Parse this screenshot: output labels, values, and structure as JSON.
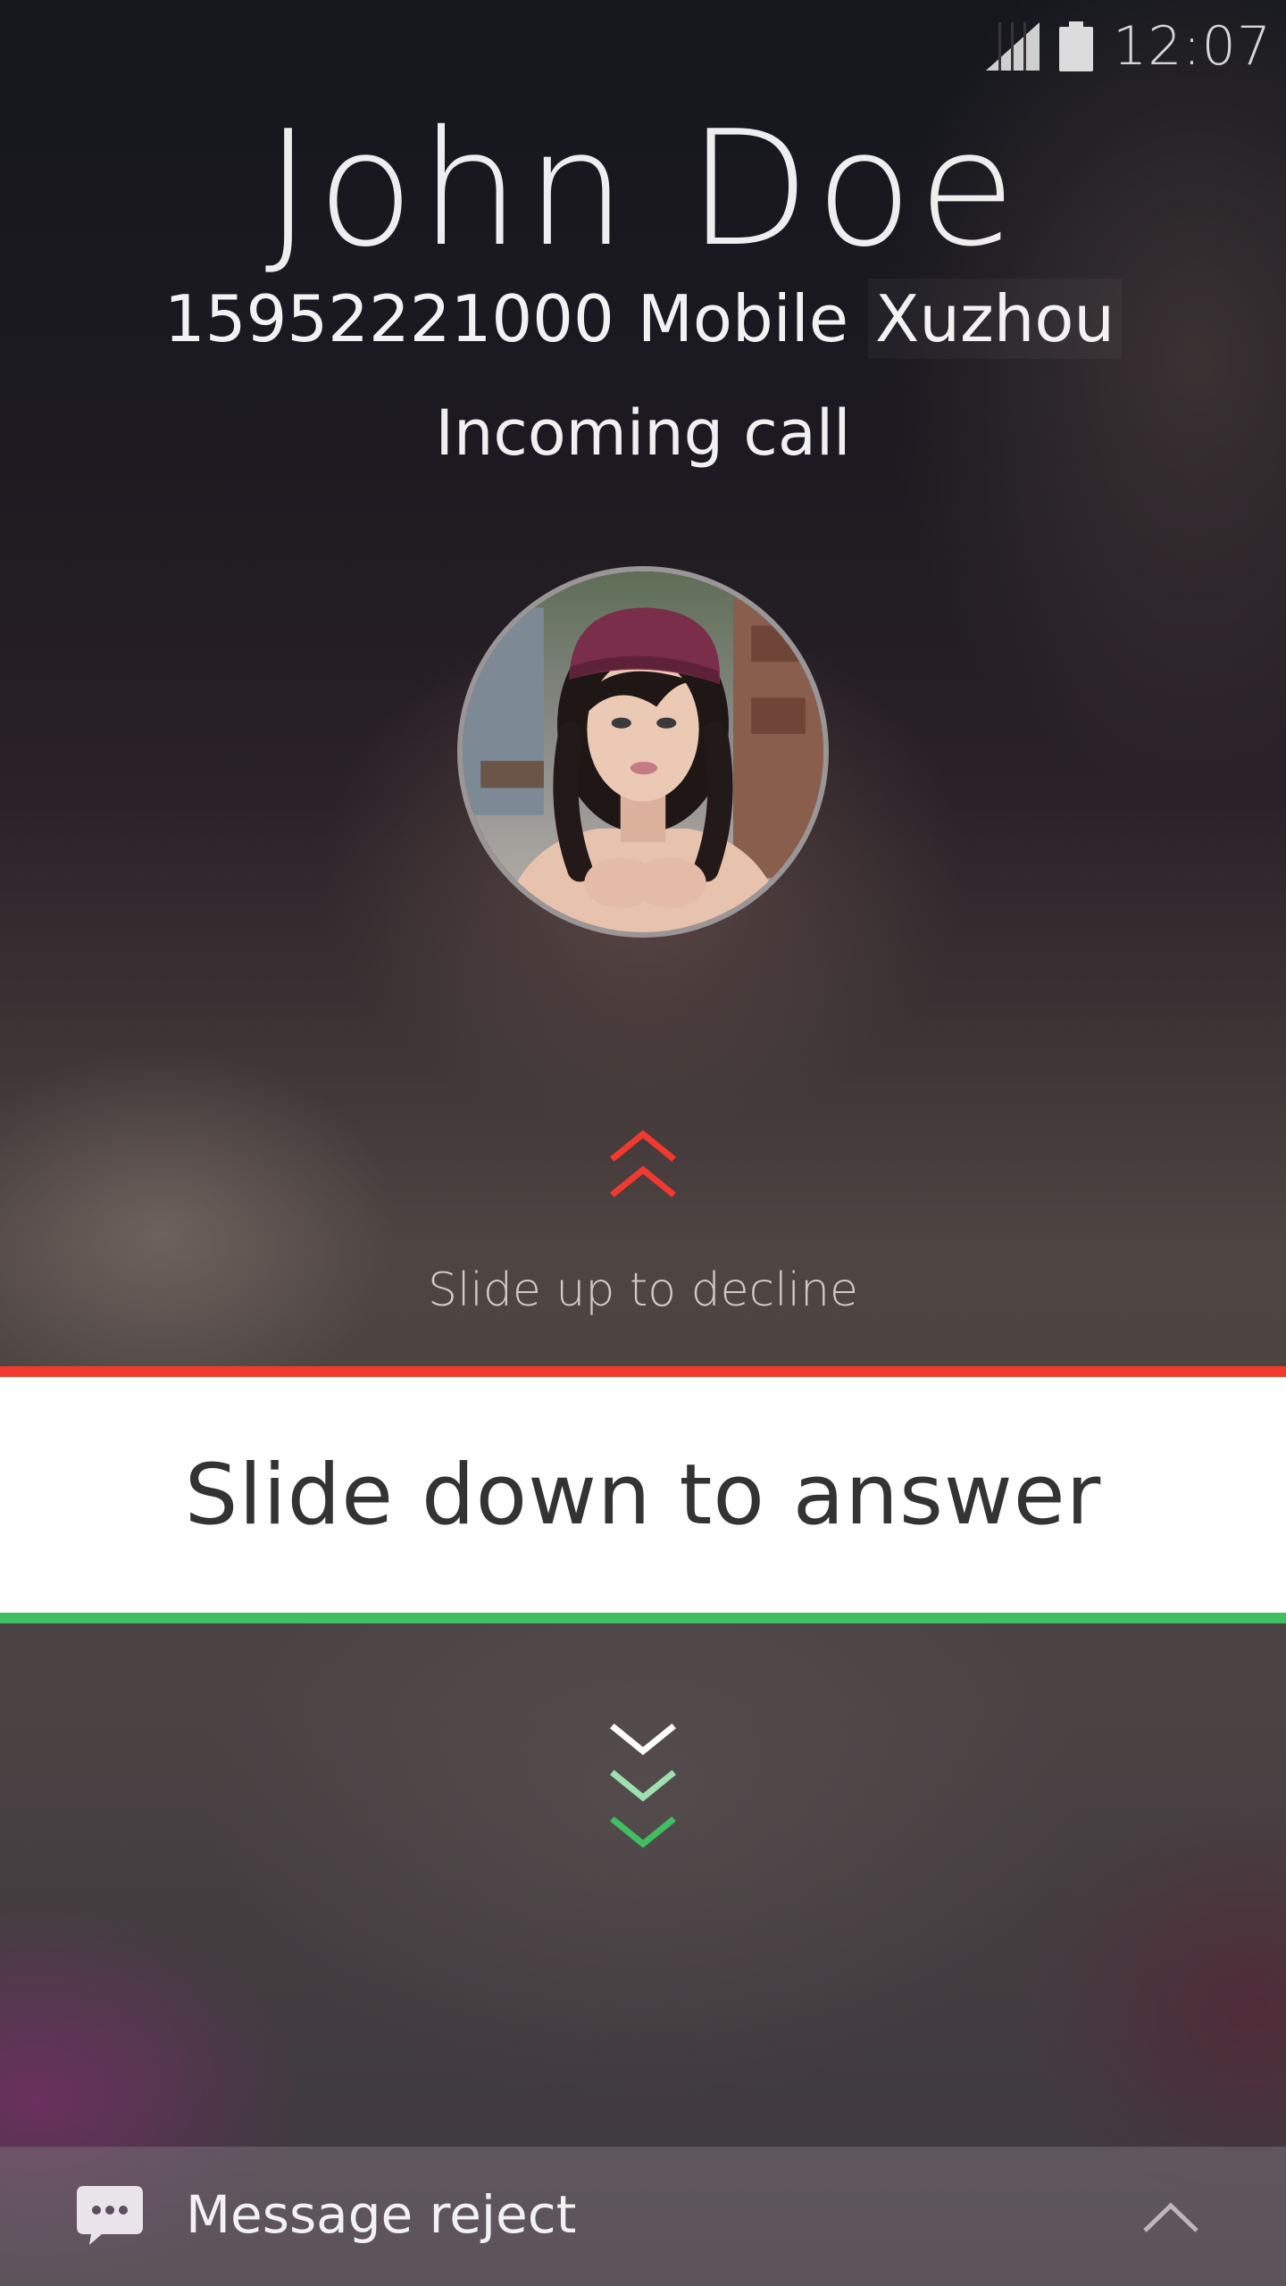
{
  "status_bar": {
    "time": "12:07",
    "signal_icon": "signal-icon",
    "battery_icon": "battery-icon"
  },
  "caller": {
    "name": "John Doe",
    "number": "15952221000",
    "number_type": "Mobile",
    "location": "Xuzhou",
    "status": "Incoming call",
    "avatar": "contact-photo"
  },
  "actions": {
    "decline_hint": "Slide up to decline",
    "answer_label": "Slide down to answer"
  },
  "bottom_bar": {
    "message_reject_label": "Message reject",
    "message_icon": "chat-bubble-icon",
    "expand_icon": "chevron-up-icon"
  },
  "colors": {
    "decline": "#f2392f",
    "answer": "#3fbf62",
    "panel": "#ffffff"
  }
}
